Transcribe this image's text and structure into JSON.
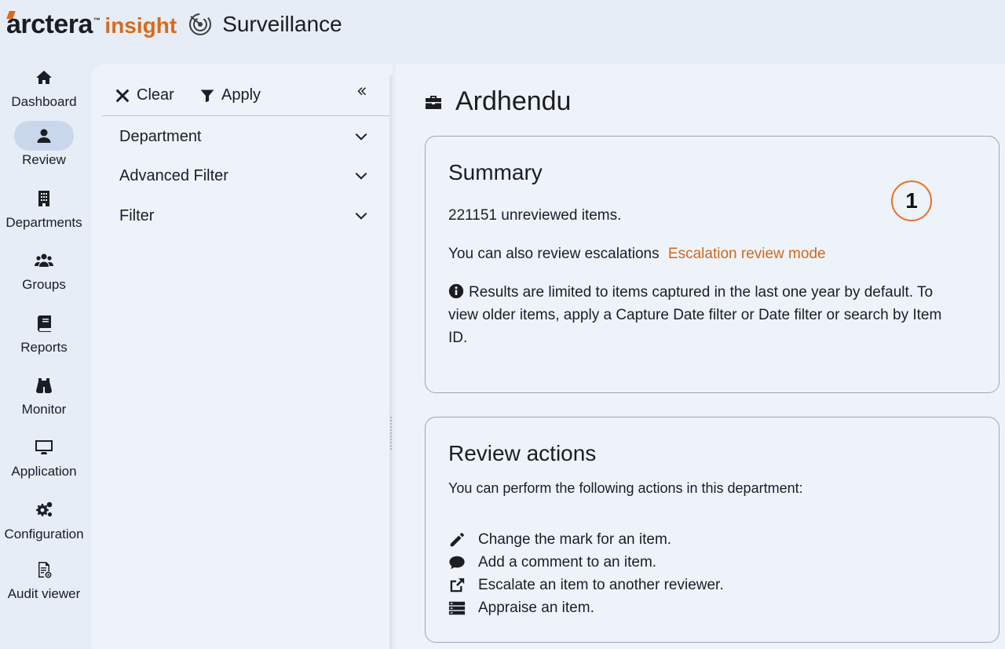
{
  "header": {
    "brand": "arctera",
    "trademark": "™",
    "brand_suffix": "insight",
    "app_title": "Surveillance",
    "brand_color": "#d96a1a"
  },
  "nav": {
    "items": [
      {
        "label": "Dashboard",
        "icon": "home-icon"
      },
      {
        "label": "Review",
        "icon": "user-icon",
        "active": true
      },
      {
        "label": "Departments",
        "icon": "building-icon"
      },
      {
        "label": "Groups",
        "icon": "users-icon"
      },
      {
        "label": "Reports",
        "icon": "book-icon"
      },
      {
        "label": "Monitor",
        "icon": "binoculars-icon"
      },
      {
        "label": "Application",
        "icon": "monitor-icon"
      },
      {
        "label": "Configuration",
        "icon": "gears-icon"
      },
      {
        "label": "Audit viewer",
        "icon": "audit-doc-icon"
      }
    ]
  },
  "filter": {
    "clear_label": "Clear",
    "apply_label": "Apply",
    "sections": [
      "Department",
      "Advanced Filter",
      "Filter"
    ]
  },
  "main": {
    "title": "Ardhendu",
    "summary": {
      "heading": "Summary",
      "unreviewed": "221151 unreviewed items.",
      "escalation_text": "You can also review escalations",
      "escalation_link": "Escalation review mode",
      "note_line1": "Results are limited to items captured in the last one year by default. To",
      "note_line2": "view older items, apply a Capture Date filter or Date filter or search by Item",
      "note_line3": "ID.",
      "badge": "1"
    },
    "actions": {
      "heading": "Review actions",
      "intro": "You can perform the following actions in this department:",
      "items": [
        "Change the mark for an item.",
        "Add a comment to an item.",
        "Escalate an item to another reviewer.",
        "Appraise an item."
      ]
    }
  },
  "colors": {
    "accent": "#cc6a1c",
    "badge_ring": "#e8702a",
    "background": "#e6edf6",
    "panel": "#eef3fa"
  }
}
